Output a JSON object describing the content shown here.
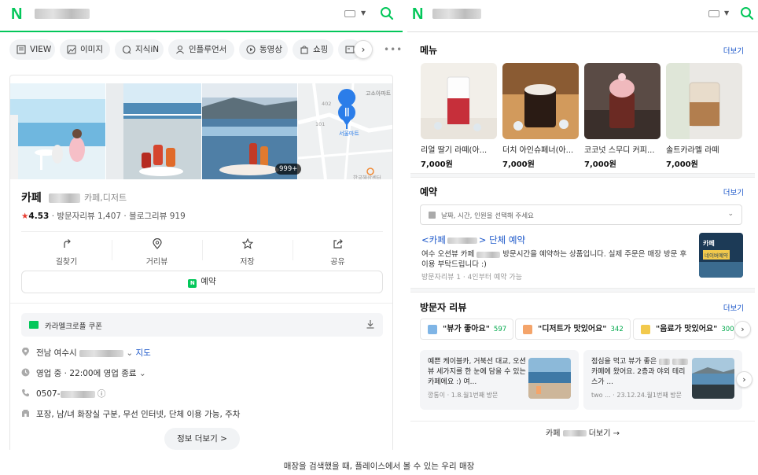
{
  "left": {
    "header": {
      "logo": "N"
    },
    "chips": [
      {
        "label": "VIEW",
        "icon": "view-icon"
      },
      {
        "label": "이미지",
        "icon": "image-icon"
      },
      {
        "label": "지식iN",
        "icon": "qna-icon"
      },
      {
        "label": "인플루언서",
        "icon": "person-icon"
      },
      {
        "label": "동영상",
        "icon": "play-icon"
      },
      {
        "label": "쇼핑",
        "icon": "bag-icon"
      }
    ],
    "map": {
      "label_top": "고소아파트",
      "label_pin": "서울마트",
      "label_a": "402",
      "label_b": "101",
      "label_bottom": "한국해상센터"
    },
    "photo_count": "999+",
    "place": {
      "name": "카페",
      "category": "카페,디저트",
      "rating": "4.53",
      "reviews": "· 방문자리뷰 1,407 · 블로그리뷰 919"
    },
    "actions": [
      {
        "label": "길찾기",
        "icon": "directions-icon"
      },
      {
        "label": "거리뷰",
        "icon": "pin-icon"
      },
      {
        "label": "저장",
        "icon": "star-icon"
      },
      {
        "label": "공유",
        "icon": "share-icon"
      }
    ],
    "reserve_label": "예약",
    "coupon_label": "카라멜크로플 쿠폰",
    "info": {
      "address": "전남 여수시",
      "map_link": "지도",
      "hours": "영업 중 · 22:00에 영업 종료",
      "phone": "0507-",
      "amenities": "포장, 남/녀 화장실 구분, 무선 인터넷, 단체 이용 가능, 주차"
    },
    "more_info": "정보 더보기 >"
  },
  "right": {
    "menu_title": "메뉴",
    "menu_more": "더보기",
    "menu_items": [
      {
        "name": "리얼 딸기 라떼(아...",
        "price": "7,000원"
      },
      {
        "name": "더치 아인슈페너(아...",
        "price": "7,000원"
      },
      {
        "name": "코코넛 스무디 커피...",
        "price": "7,000원"
      },
      {
        "name": "솔트카라멜 라떼",
        "price": "7,000원"
      }
    ],
    "reserve_title": "예약",
    "reserve_more": "더보기",
    "reserve_select": "날짜, 시간, 인원을 선택해 주세요",
    "reserve_item_title_a": "<카페",
    "reserve_item_title_b": "> 단체 예약",
    "reserve_desc_a": "여수 오션뷰 카페",
    "reserve_desc_b": "방문시간을 예약하는 상품입니다. 실제 주문은 매장 방문 후 이용 부탁드립니다 :)",
    "reserve_meta": "방문자리뷰 1 · 4인부터 예약 가능",
    "reserve_thumb_a": "카페",
    "reserve_thumb_b": "네이버예약",
    "review_title": "방문자 리뷰",
    "review_more": "더보기",
    "keywords": [
      {
        "label": "\"뷰가 좋아요\"",
        "count": "597"
      },
      {
        "label": "\"디저트가 맛있어요\"",
        "count": "342"
      },
      {
        "label": "\"음료가 맛있어요\"",
        "count": "300"
      }
    ],
    "reviews": [
      {
        "text": "예쁜 케이블카, 거북선 대교, 오션뷰 세가지를 한 눈에 담을 수 있는 카페에요 :) 여...",
        "meta": "깡통이 · 1.8.월1번째 방문"
      },
      {
        "text_a": "점심을 먹고 뷰가 좋은",
        "text_b": "카페에 왔어요. 2층과 야외 테리스가 ...",
        "meta": "two ... · 23.12.24.월1번째 방문"
      }
    ],
    "more_place_a": "카페",
    "more_place_b": "더보기 →"
  },
  "caption": "매장을 검색했을 때, 플레이스에서 볼 수 있는 우리 매장",
  "colors": {
    "brand": "#03c75a",
    "link": "#1a56c9",
    "star": "#e73a2e"
  }
}
